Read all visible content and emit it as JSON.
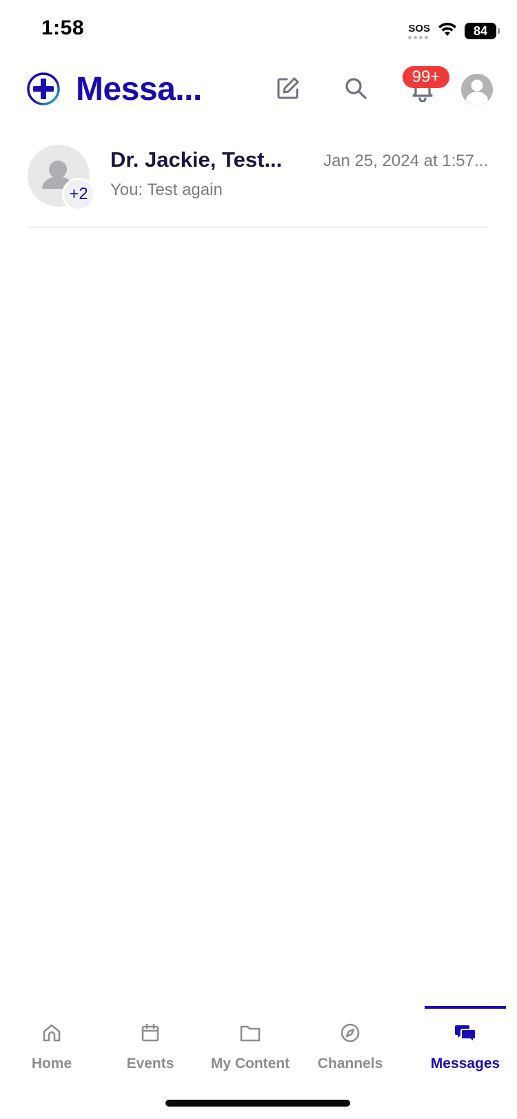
{
  "status_bar": {
    "time": "1:58",
    "sos": "SOS",
    "battery": "84"
  },
  "header": {
    "title": "Messa...",
    "notification_count": "99+"
  },
  "conversations": [
    {
      "name": "Dr. Jackie, Test...",
      "timestamp": "Jan 25, 2024 at 1:57...",
      "preview": "You: Test again",
      "extra_participants": "+2"
    }
  ],
  "tabs": [
    {
      "label": "Home",
      "icon": "home-icon"
    },
    {
      "label": "Events",
      "icon": "calendar-icon"
    },
    {
      "label": "My Content",
      "icon": "folder-icon"
    },
    {
      "label": "Channels",
      "icon": "compass-icon"
    },
    {
      "label": "Messages",
      "icon": "chat-bubbles-icon",
      "active": true
    }
  ],
  "colors": {
    "brand": "#1a0bb3",
    "badge": "#f03a3a",
    "muted_text": "#7a7a80",
    "tab_inactive": "#8d8d92"
  }
}
